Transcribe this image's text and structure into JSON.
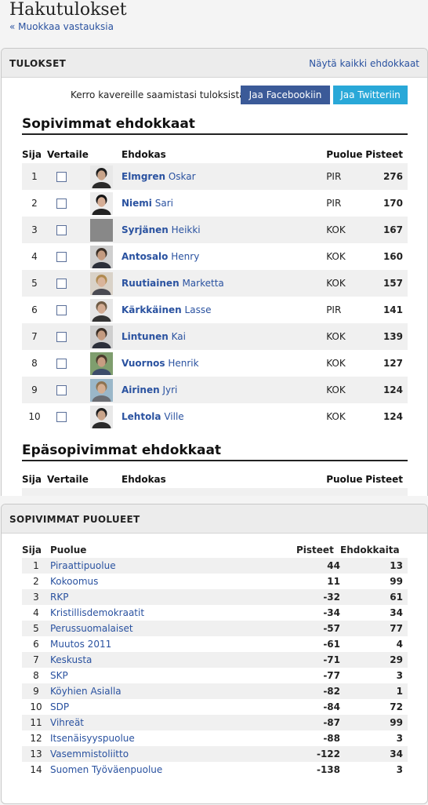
{
  "page": {
    "title": "Hakutulokset",
    "back_link": "« Muokkaa vastauksia"
  },
  "results_panel": {
    "title": "TULOKSET",
    "show_all": "Näytä kaikki ehdokkaat",
    "share_text": "Kerro kavereille saamistasi tuloksista:",
    "facebook_button": "Jaa Facebookiin",
    "twitter_button": "Jaa Twitteriin",
    "best_title": "Sopivimmat ehdokkaat",
    "worst_title": "Epäsopivimmat ehdokkaat",
    "columns": {
      "rank": "Sija",
      "compare": "Vertaile",
      "candidate": "Ehdokas",
      "party": "Puolue",
      "points": "Pisteet"
    },
    "candidates": [
      {
        "rank": "1",
        "last": "Elmgren",
        "first": "Oskar",
        "party": "PIR",
        "points": "276",
        "photo": "dark-suit"
      },
      {
        "rank": "2",
        "last": "Niemi",
        "first": "Sari",
        "party": "PIR",
        "points": "170",
        "photo": "dark-hair-woman"
      },
      {
        "rank": "3",
        "last": "Syrjänen",
        "first": "Heikki",
        "party": "KOK",
        "points": "167",
        "photo": "blank"
      },
      {
        "rank": "4",
        "last": "Antosalo",
        "first": "Henry",
        "party": "KOK",
        "points": "160",
        "photo": "suit"
      },
      {
        "rank": "5",
        "last": "Ruutiainen",
        "first": "Marketta",
        "party": "KOK",
        "points": "157",
        "photo": "blonde-woman"
      },
      {
        "rank": "6",
        "last": "Kärkkäinen",
        "first": "Lasse",
        "party": "PIR",
        "points": "141",
        "photo": "light-man"
      },
      {
        "rank": "7",
        "last": "Lintunen",
        "first": "Kai",
        "party": "KOK",
        "points": "139",
        "photo": "suit"
      },
      {
        "rank": "8",
        "last": "Vuornos",
        "first": "Henrik",
        "party": "KOK",
        "points": "127",
        "photo": "outdoor"
      },
      {
        "rank": "9",
        "last": "Airinen",
        "first": "Jyri",
        "party": "KOK",
        "points": "124",
        "photo": "outdoor-light"
      },
      {
        "rank": "10",
        "last": "Lehtola",
        "first": "Ville",
        "party": "KOK",
        "points": "124",
        "photo": "dark-suit"
      }
    ]
  },
  "parties_panel": {
    "title": "SOPIVIMMAT PUOLUEET",
    "columns": {
      "rank": "Sija",
      "party": "Puolue",
      "points": "Pisteet",
      "candidates": "Ehdokkaita"
    },
    "parties": [
      {
        "rank": "1",
        "name": "Piraattipuolue",
        "points": "44",
        "candidates": "13"
      },
      {
        "rank": "2",
        "name": "Kokoomus",
        "points": "11",
        "candidates": "99"
      },
      {
        "rank": "3",
        "name": "RKP",
        "points": "-32",
        "candidates": "61"
      },
      {
        "rank": "4",
        "name": "Kristillisdemokraatit",
        "points": "-34",
        "candidates": "34"
      },
      {
        "rank": "5",
        "name": "Perussuomalaiset",
        "points": "-57",
        "candidates": "77"
      },
      {
        "rank": "6",
        "name": "Muutos 2011",
        "points": "-61",
        "candidates": "4"
      },
      {
        "rank": "7",
        "name": "Keskusta",
        "points": "-71",
        "candidates": "29"
      },
      {
        "rank": "8",
        "name": "SKP",
        "points": "-77",
        "candidates": "3"
      },
      {
        "rank": "9",
        "name": "Köyhien Asialla",
        "points": "-82",
        "candidates": "1"
      },
      {
        "rank": "10",
        "name": "SDP",
        "points": "-84",
        "candidates": "72"
      },
      {
        "rank": "11",
        "name": "Vihreät",
        "points": "-87",
        "candidates": "99"
      },
      {
        "rank": "12",
        "name": "Itsenäisyyspuolue",
        "points": "-88",
        "candidates": "3"
      },
      {
        "rank": "13",
        "name": "Vasemmistoliitto",
        "points": "-122",
        "candidates": "34"
      },
      {
        "rank": "14",
        "name": "Suomen Työväenpuolue",
        "points": "-138",
        "candidates": "3"
      }
    ]
  }
}
